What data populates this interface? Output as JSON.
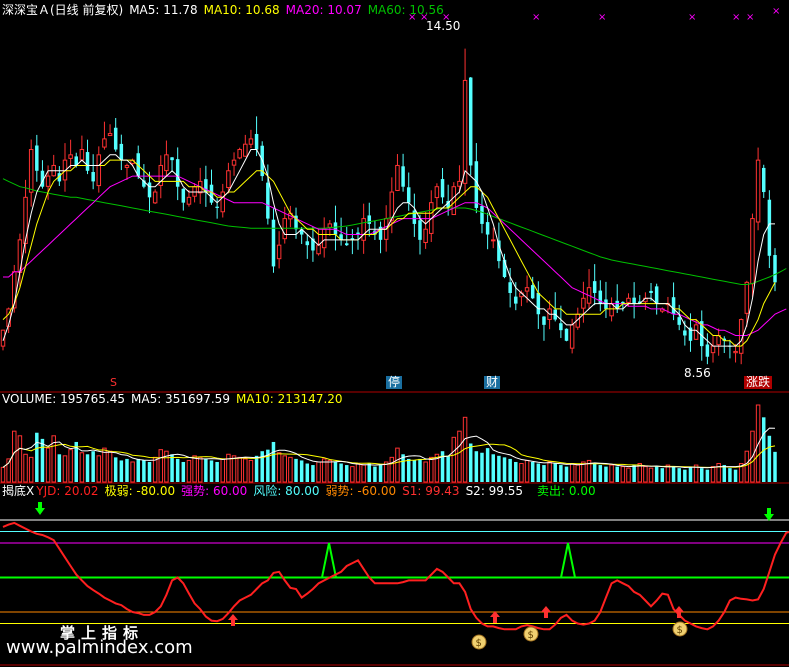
{
  "main_header": {
    "title": "深深宝Ａ(日线 前复权)",
    "ma5": "MA5: 11.78",
    "ma10": "MA10: 10.68",
    "ma20": "MA20: 10.07",
    "ma60": "MA60: 10.56"
  },
  "volume_header": {
    "volume": "VOLUME: 195765.45",
    "ma5": "MA5: 351697.59",
    "ma10": "MA10: 213147.20"
  },
  "indicator_header": {
    "name": "揭底X",
    "yjd": "YJD: 20.02",
    "jr": "极弱: -80.00",
    "qs": "强势: 60.00",
    "fx": "风险: 80.00",
    "rs": "弱势: -60.00",
    "s1": "S1: 99.43",
    "s2": "S2: 99.55",
    "mc": "卖出: 0.00"
  },
  "annotations": {
    "high": "14.50",
    "low": "8.56",
    "tag_s": "S",
    "tag_ting": "停",
    "tag_cai": "财",
    "tag_zhangdie": "涨跌"
  },
  "watermark": {
    "line1": "掌上指标",
    "line2": "www.palmindex.com"
  },
  "colors": {
    "up": "#ff3232",
    "down": "#54ffff",
    "ma5": "#ffffff",
    "ma10": "#ffff00",
    "ma20": "#ff00ff",
    "ma60": "#00c000",
    "yjd": "#ff2020",
    "strong": "#ff00ff",
    "risk": "#54ffff",
    "sell": "#00ff00"
  },
  "chart_data": [
    {
      "type": "candlestick",
      "title": "深深宝Ａ(日线 前复权)",
      "ylim": [
        8.3,
        15.0
      ],
      "annotated_high": 14.5,
      "annotated_low": 8.56,
      "close": [
        9.2,
        9.6,
        10.3,
        10.9,
        11.7,
        12.6,
        12.2,
        11.9,
        12.1,
        12.3,
        12.0,
        12.4,
        12.5,
        12.3,
        12.6,
        12.2,
        12.0,
        12.5,
        12.8,
        12.9,
        12.6,
        12.4,
        12.3,
        12.4,
        12.1,
        11.9,
        11.7,
        11.8,
        12.3,
        12.5,
        12.4,
        11.9,
        11.6,
        11.7,
        11.9,
        12.0,
        11.8,
        11.6,
        11.5,
        11.8,
        12.2,
        12.4,
        12.6,
        12.7,
        12.8,
        12.6,
        12.1,
        11.3,
        10.4,
        10.8,
        11.3,
        11.4,
        11.1,
        11.0,
        10.8,
        10.7,
        10.8,
        11.1,
        11.2,
        11.0,
        10.9,
        10.8,
        10.9,
        11.0,
        11.3,
        11.2,
        11.0,
        10.9,
        11.3,
        11.8,
        12.3,
        11.9,
        11.6,
        11.2,
        10.9,
        11.1,
        11.6,
        11.9,
        11.7,
        11.5,
        11.9,
        12.0,
        13.9,
        12.3,
        11.5,
        11.2,
        11.0,
        10.9,
        10.5,
        10.2,
        9.9,
        9.7,
        9.9,
        10.0,
        9.8,
        9.5,
        9.3,
        9.6,
        9.4,
        9.2,
        9.0,
        9.3,
        9.5,
        9.8,
        10.0,
        9.9,
        9.7,
        9.6,
        9.7,
        9.6,
        9.7,
        9.8,
        9.7,
        9.7,
        9.8,
        9.9,
        9.7,
        9.6,
        9.7,
        9.5,
        9.3,
        9.1,
        9.0,
        9.3,
        8.9,
        8.7,
        8.9,
        9.1,
        9.0,
        8.9,
        8.8,
        9.4,
        10.1,
        11.3,
        12.4,
        11.8,
        10.6,
        10.1
      ],
      "ma5": [
        9.0,
        9.3,
        9.7,
        10.3,
        10.9,
        11.4,
        11.8,
        12.0,
        12.2,
        12.2,
        12.2,
        12.2,
        12.3,
        12.3,
        12.4,
        12.3,
        12.3,
        12.3,
        12.4,
        12.5,
        12.5,
        12.4,
        12.4,
        12.3,
        12.1,
        12.0,
        11.9,
        11.9,
        12.0,
        12.1,
        12.2,
        12.1,
        11.9,
        11.8,
        11.8,
        11.8,
        11.8,
        11.7,
        11.6,
        11.7,
        11.8,
        12.0,
        12.2,
        12.4,
        12.6,
        12.6,
        12.4,
        12.1,
        11.6,
        11.2,
        11.0,
        11.0,
        11.0,
        11.1,
        11.0,
        10.9,
        10.8,
        10.9,
        10.9,
        10.9,
        10.9,
        10.9,
        10.9,
        10.9,
        11.0,
        11.1,
        11.1,
        11.1,
        11.1,
        11.3,
        11.5,
        11.6,
        11.6,
        11.5,
        11.3,
        11.2,
        11.3,
        11.4,
        11.5,
        11.6,
        11.7,
        11.8,
        12.2,
        12.1,
        12.0,
        11.8,
        11.5,
        11.2,
        10.8,
        10.5,
        10.2,
        10.0,
        9.9,
        9.8,
        9.7,
        9.6,
        9.6,
        9.5,
        9.5,
        9.4,
        9.3,
        9.3,
        9.4,
        9.5,
        9.6,
        9.7,
        9.7,
        9.7,
        9.7,
        9.6,
        9.6,
        9.7,
        9.7,
        9.7,
        9.8,
        9.8,
        9.7,
        9.7,
        9.7,
        9.6,
        9.5,
        9.3,
        9.2,
        9.2,
        9.1,
        9.0,
        8.9,
        8.9,
        8.9,
        8.9,
        8.9,
        9.0,
        9.3,
        9.8,
        10.5,
        11.0,
        11.2,
        11.2
      ],
      "ma10": [
        9.4,
        9.5,
        9.7,
        10.0,
        10.4,
        10.8,
        11.2,
        11.5,
        11.8,
        12.0,
        12.1,
        12.2,
        12.2,
        12.3,
        12.3,
        12.3,
        12.3,
        12.3,
        12.3,
        12.4,
        12.4,
        12.4,
        12.4,
        12.4,
        12.3,
        12.2,
        12.1,
        12.0,
        12.0,
        12.0,
        12.0,
        12.0,
        12.0,
        11.9,
        11.9,
        11.9,
        11.8,
        11.8,
        11.7,
        11.7,
        11.8,
        11.8,
        11.9,
        12.0,
        12.1,
        12.2,
        12.2,
        12.1,
        12.0,
        11.8,
        11.6,
        11.4,
        11.3,
        11.2,
        11.1,
        11.1,
        11.0,
        11.0,
        11.0,
        11.0,
        10.9,
        10.9,
        10.9,
        10.9,
        11.0,
        11.0,
        11.0,
        11.1,
        11.1,
        11.2,
        11.3,
        11.3,
        11.4,
        11.4,
        11.4,
        11.4,
        11.4,
        11.5,
        11.5,
        11.5,
        11.6,
        11.7,
        11.8,
        11.9,
        11.9,
        11.8,
        11.7,
        11.5,
        11.3,
        11.1,
        10.9,
        10.7,
        10.5,
        10.3,
        10.1,
        9.9,
        9.8,
        9.7,
        9.6,
        9.6,
        9.5,
        9.5,
        9.5,
        9.5,
        9.5,
        9.5,
        9.5,
        9.6,
        9.6,
        9.6,
        9.7,
        9.7,
        9.7,
        9.7,
        9.7,
        9.7,
        9.7,
        9.7,
        9.7,
        9.6,
        9.6,
        9.5,
        9.4,
        9.4,
        9.3,
        9.2,
        9.1,
        9.1,
        9.0,
        9.0,
        8.9,
        8.9,
        9.0,
        9.2,
        9.4,
        9.7,
        9.9,
        10.1
      ],
      "ma20": [
        10.2,
        10.2,
        10.3,
        10.3,
        10.4,
        10.5,
        10.6,
        10.7,
        10.8,
        10.9,
        11.0,
        11.1,
        11.2,
        11.3,
        11.4,
        11.5,
        11.6,
        11.7,
        11.8,
        11.9,
        11.95,
        12.0,
        12.05,
        12.1,
        12.1,
        12.1,
        12.1,
        12.1,
        12.1,
        12.1,
        12.1,
        12.1,
        12.05,
        12.0,
        11.95,
        11.9,
        11.85,
        11.8,
        11.75,
        11.7,
        11.65,
        11.6,
        11.6,
        11.6,
        11.6,
        11.6,
        11.6,
        11.55,
        11.5,
        11.45,
        11.4,
        11.35,
        11.3,
        11.25,
        11.2,
        11.15,
        11.1,
        11.1,
        11.1,
        11.1,
        11.05,
        11.0,
        11.0,
        11.0,
        11.0,
        11.0,
        11.05,
        11.1,
        11.15,
        11.2,
        11.25,
        11.3,
        11.3,
        11.3,
        11.3,
        11.3,
        11.3,
        11.35,
        11.4,
        11.45,
        11.5,
        11.55,
        11.6,
        11.6,
        11.6,
        11.55,
        11.5,
        11.4,
        11.3,
        11.2,
        11.1,
        11.0,
        10.9,
        10.8,
        10.7,
        10.6,
        10.5,
        10.4,
        10.3,
        10.2,
        10.1,
        10.0,
        9.95,
        9.9,
        9.85,
        9.8,
        9.75,
        9.7,
        9.7,
        9.7,
        9.7,
        9.65,
        9.65,
        9.65,
        9.65,
        9.6,
        9.6,
        9.6,
        9.55,
        9.5,
        9.5,
        9.45,
        9.4,
        9.35,
        9.3,
        9.3,
        9.25,
        9.2,
        9.2,
        9.15,
        9.1,
        9.1,
        9.1,
        9.15,
        9.2,
        9.3,
        9.4,
        9.5,
        9.55,
        9.6
      ],
      "ma60": [
        12.05,
        12.0,
        11.95,
        11.9,
        11.88,
        11.85,
        11.82,
        11.8,
        11.78,
        11.76,
        11.74,
        11.72,
        11.7,
        11.7,
        11.68,
        11.66,
        11.64,
        11.62,
        11.6,
        11.58,
        11.56,
        11.54,
        11.52,
        11.5,
        11.48,
        11.46,
        11.44,
        11.42,
        11.4,
        11.38,
        11.36,
        11.34,
        11.32,
        11.3,
        11.28,
        11.26,
        11.24,
        11.22,
        11.2,
        11.18,
        11.16,
        11.15,
        11.14,
        11.13,
        11.12,
        11.12,
        11.12,
        11.12,
        11.12,
        11.12,
        11.12,
        11.12,
        11.12,
        11.12,
        11.12,
        11.12,
        11.12,
        11.12,
        11.13,
        11.14,
        11.15,
        11.16,
        11.18,
        11.2,
        11.22,
        11.24,
        11.26,
        11.28,
        11.3,
        11.32,
        11.34,
        11.36,
        11.38,
        11.4,
        11.42,
        11.44,
        11.46,
        11.48,
        11.5,
        11.5,
        11.5,
        11.5,
        11.5,
        11.48,
        11.45,
        11.42,
        11.38,
        11.34,
        11.3,
        11.26,
        11.22,
        11.18,
        11.14,
        11.1,
        11.06,
        11.02,
        10.98,
        10.94,
        10.9,
        10.86,
        10.82,
        10.78,
        10.74,
        10.7,
        10.66,
        10.62,
        10.58,
        10.55,
        10.52,
        10.5,
        10.48,
        10.46,
        10.44,
        10.42,
        10.4,
        10.38,
        10.36,
        10.34,
        10.32,
        10.3,
        10.28,
        10.26,
        10.24,
        10.22,
        10.2,
        10.18,
        10.16,
        10.14,
        10.12,
        10.1,
        10.08,
        10.06,
        10.06,
        10.08,
        10.12,
        10.16,
        10.2,
        10.25,
        10.3,
        10.36
      ]
    },
    {
      "type": "bar",
      "title": "VOLUME",
      "values": [
        95000,
        150000,
        330000,
        300000,
        180000,
        160000,
        320000,
        280000,
        220000,
        300000,
        180000,
        170000,
        210000,
        260000,
        190000,
        180000,
        200000,
        170000,
        220000,
        200000,
        160000,
        140000,
        150000,
        130000,
        150000,
        140000,
        130000,
        160000,
        210000,
        200000,
        180000,
        150000,
        130000,
        140000,
        170000,
        160000,
        150000,
        140000,
        130000,
        150000,
        180000,
        170000,
        160000,
        150000,
        140000,
        170000,
        200000,
        210000,
        260000,
        190000,
        170000,
        160000,
        150000,
        140000,
        120000,
        110000,
        130000,
        150000,
        140000,
        130000,
        120000,
        110000,
        100000,
        120000,
        110000,
        120000,
        100000,
        110000,
        130000,
        160000,
        220000,
        180000,
        150000,
        140000,
        150000,
        130000,
        160000,
        180000,
        200000,
        170000,
        290000,
        330000,
        420000,
        250000,
        200000,
        190000,
        220000,
        180000,
        170000,
        160000,
        150000,
        130000,
        120000,
        140000,
        130000,
        120000,
        110000,
        130000,
        120000,
        110000,
        100000,
        120000,
        110000,
        130000,
        140000,
        120000,
        110000,
        100000,
        110000,
        100000,
        100000,
        90000,
        110000,
        120000,
        100000,
        90000,
        100000,
        90000,
        110000,
        100000,
        90000,
        80000,
        100000,
        110000,
        90000,
        80000,
        100000,
        120000,
        110000,
        90000,
        80000,
        120000,
        200000,
        330000,
        500000,
        420000,
        300000,
        195765.45
      ]
    },
    {
      "type": "line",
      "title": "揭底X",
      "series": [
        {
          "name": "YJD",
          "values": [
            88,
            92,
            95,
            90,
            85,
            80,
            76,
            74,
            70,
            65,
            50,
            35,
            20,
            5,
            -5,
            -15,
            -22,
            -28,
            -35,
            -40,
            -45,
            -48,
            -55,
            -60,
            -62,
            -65,
            -65,
            -60,
            -50,
            -30,
            -5,
            0,
            -10,
            -28,
            -45,
            -55,
            -68,
            -75,
            -76,
            -72,
            -62,
            -50,
            -40,
            -35,
            -30,
            -20,
            -10,
            -5,
            8,
            10,
            -5,
            -18,
            -20,
            -35,
            -28,
            -20,
            -10,
            -5,
            0,
            5,
            10,
            20,
            25,
            30,
            15,
            0,
            -10,
            -10,
            -10,
            -10,
            -10,
            -8,
            -5,
            -5,
            -5,
            -5,
            5,
            15,
            10,
            0,
            -10,
            -10,
            -25,
            -55,
            -70,
            -80,
            -85,
            -85,
            -88,
            -90,
            -90,
            -90,
            -85,
            -83,
            -85,
            -88,
            -90,
            -90,
            -82,
            -70,
            -65,
            -75,
            -80,
            -82,
            -80,
            -75,
            -60,
            -35,
            -10,
            -5,
            -10,
            -15,
            -25,
            -30,
            -40,
            -50,
            -40,
            -28,
            -30,
            -55,
            -65,
            -75,
            -80,
            -85,
            -88,
            -90,
            -85,
            -75,
            -60,
            -40,
            -35,
            -37,
            -38,
            -40,
            -38,
            -20,
            10,
            40,
            60,
            78,
            80,
            72,
            60,
            30,
            20.02
          ]
        }
      ],
      "reference_lines": {
        "风险": 80,
        "强势": 60,
        "卖出": 0,
        "弱势": -60,
        "极弱": -80
      },
      "ylim": [
        -100,
        100
      ]
    }
  ]
}
